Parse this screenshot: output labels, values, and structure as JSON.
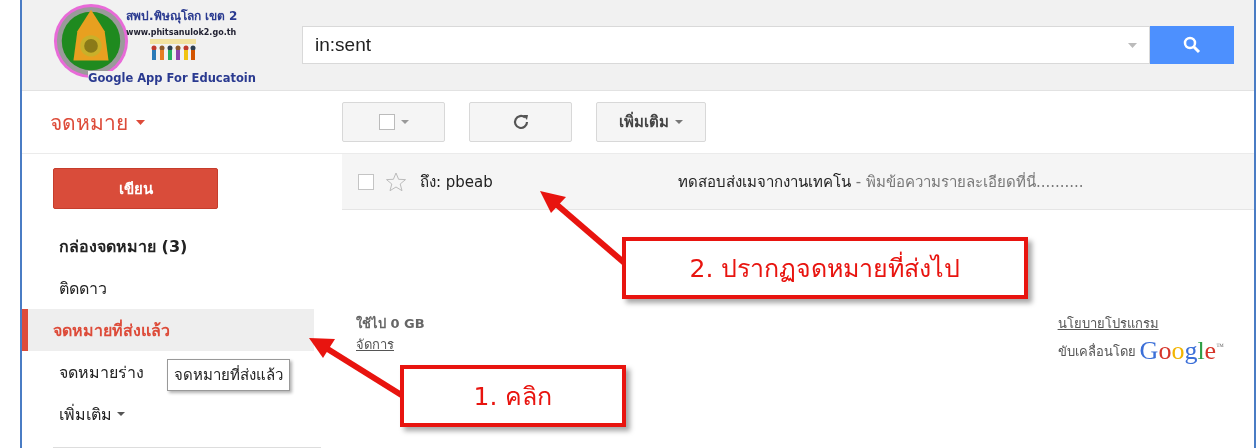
{
  "header": {
    "logo": {
      "title": "สพป.พิษณุโลก เขต 2",
      "url": "www.phitsanulok2.go.th",
      "caption": "Google App For Educatoin"
    },
    "search": {
      "value": "in:sent"
    }
  },
  "app_menu": {
    "label": "จดหมาย"
  },
  "toolbar": {
    "buttons": [
      {
        "kind": "select",
        "checked": false
      },
      {
        "kind": "refresh"
      },
      {
        "kind": "more",
        "label": "เพิ่มเติม"
      }
    ]
  },
  "compose": {
    "label": "เขียน"
  },
  "nav": [
    {
      "kind": "folder",
      "label": "กล่องจดหมาย (3)",
      "bold": true,
      "selected": false
    },
    {
      "kind": "folder",
      "label": "ติดดาว",
      "bold": false,
      "selected": false
    },
    {
      "kind": "folder",
      "label": "จดหมายที่ส่งแล้ว",
      "bold": false,
      "selected": true
    },
    {
      "kind": "folder",
      "label": "จดหมายร่าง",
      "bold": false,
      "selected": false
    },
    {
      "kind": "more",
      "label": "เพิ่มเติม",
      "bold": false,
      "selected": false
    }
  ],
  "tooltip": {
    "text": "จดหมายที่ส่งแล้ว"
  },
  "messages": [
    {
      "to": "ถึง: pbeab",
      "subject": "ทดสอบส่งเมจากงานเทคโน",
      "snippet": "- พิมข้อความรายละเอียดที่นี่..........",
      "checked": false,
      "starred": false
    }
  ],
  "footer": {
    "storage": "ใช้ไป 0 GB",
    "manage": "จัดการ",
    "policy": "นโยบายโปรแกรม",
    "powered": "ขับเคลื่อนโดย",
    "brand": "Google",
    "tm": "™"
  },
  "annotations": [
    {
      "text": "2. ปรากฏจดหมายที่ส่งไป"
    },
    {
      "text": "1. คลิก"
    }
  ]
}
